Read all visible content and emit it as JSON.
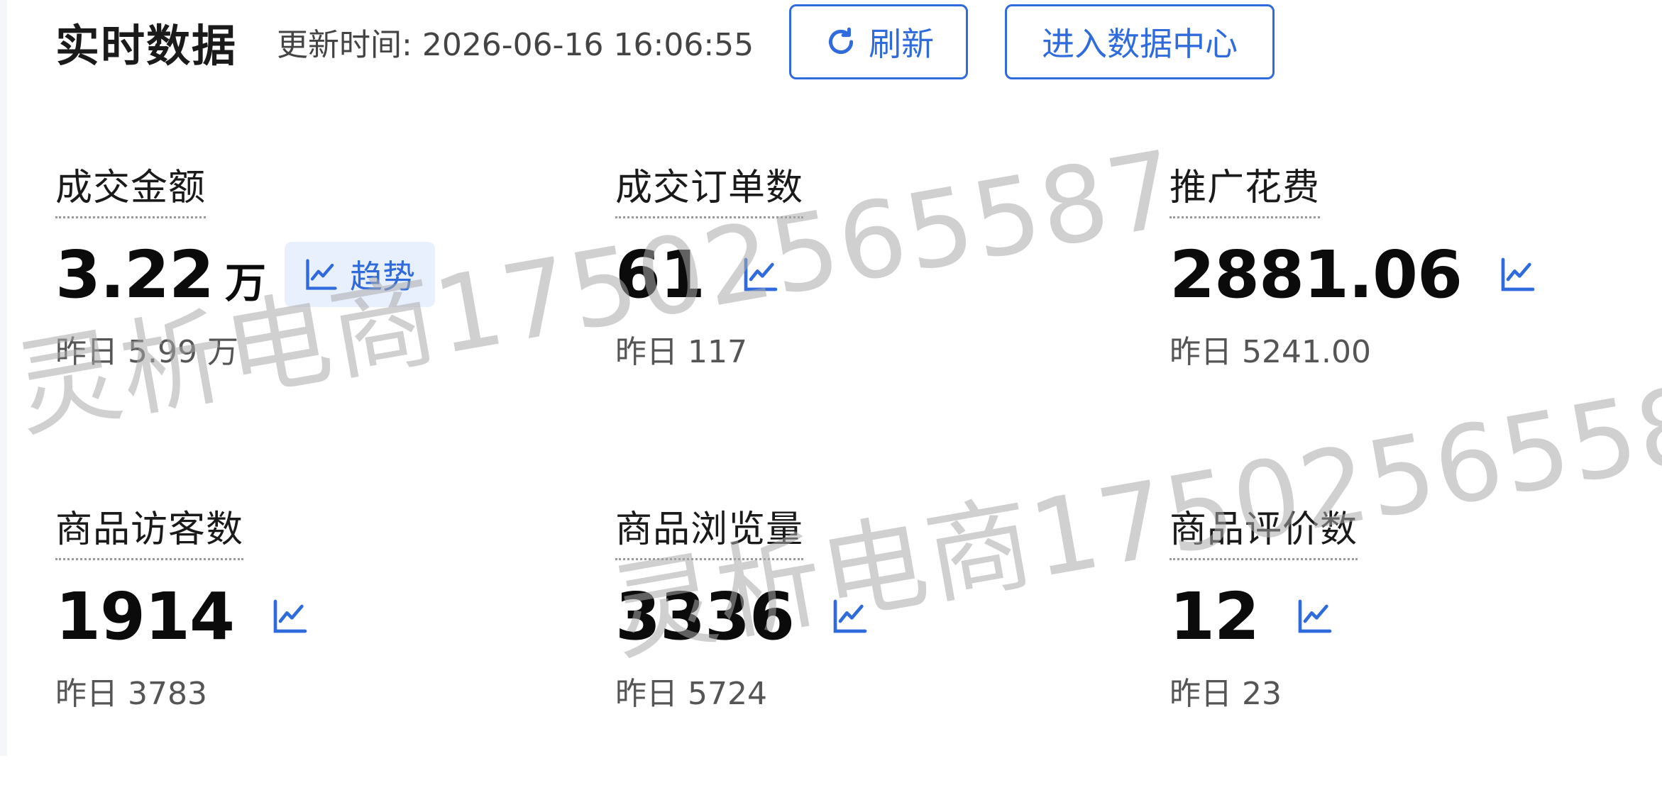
{
  "header": {
    "title": "实时数据",
    "update_time": "更新时间: 2026-06-16 16:06:55",
    "refresh_label": "刷新",
    "data_center_label": "进入数据中心"
  },
  "metrics": [
    {
      "label": "成交金额",
      "value": "3.22",
      "unit": "万",
      "trend_label": "趋势",
      "previous": "昨日 5.99 万"
    },
    {
      "label": "成交订单数",
      "value": "61",
      "previous": "昨日 117"
    },
    {
      "label": "推广花费",
      "value": "2881.06",
      "previous": "昨日 5241.00"
    },
    {
      "label": "商品访客数",
      "value": "1914",
      "previous": "昨日 3783"
    },
    {
      "label": "商品浏览量",
      "value": "3336",
      "previous": "昨日 5724"
    },
    {
      "label": "商品评价数",
      "value": "12",
      "previous": "昨日 23"
    }
  ],
  "watermark": {
    "text": "灵析电商17502565587"
  },
  "colors": {
    "accent": "#2f6bdc",
    "chip_bg": "#e9f0fd",
    "watermark": "#aaaaaa"
  },
  "icons": {
    "refresh": "refresh-icon",
    "trend": "line-chart-icon"
  }
}
